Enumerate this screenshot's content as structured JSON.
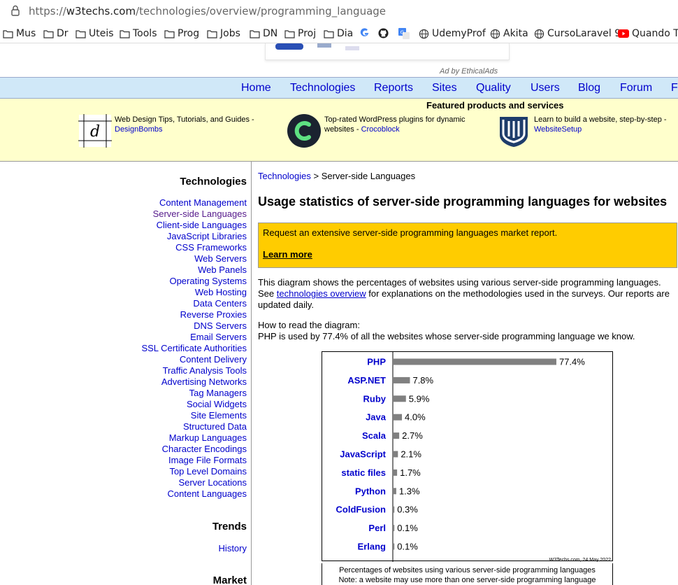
{
  "browser": {
    "url_prefix": "https://",
    "url_host": "w3techs.com",
    "url_path": "/technologies/overview/programming_language",
    "bookmarks": [
      "Mus",
      "Dr",
      "Uteis",
      "Tools",
      "Prog",
      "Jobs",
      "DN",
      "Proj",
      "Dia",
      "",
      "",
      "",
      "UdemyProf",
      "Akita",
      "CursoLaravel 9",
      "Quando Tu"
    ]
  },
  "ad": {
    "by": "Ad by EthicalAds"
  },
  "nav": [
    "Home",
    "Technologies",
    "Reports",
    "Sites",
    "Quality",
    "Users",
    "Blog",
    "Forum",
    "F"
  ],
  "featured": {
    "title": "Featured products and services",
    "items": [
      {
        "text": "Web Design Tips, Tutorials, and Guides - ",
        "link": "DesignBombs"
      },
      {
        "text": "Top-rated WordPress plugins for dynamic websites - ",
        "link": "Crocoblock"
      },
      {
        "text": "Learn to build a website, step-by-step - ",
        "link": "WebsiteSetup"
      }
    ]
  },
  "sidebar": {
    "technologies_heading": "Technologies",
    "items": [
      "Content Management",
      "Server-side Languages",
      "Client-side Languages",
      "JavaScript Libraries",
      "CSS Frameworks",
      "Web Servers",
      "Web Panels",
      "Operating Systems",
      "Web Hosting",
      "Data Centers",
      "Reverse Proxies",
      "DNS Servers",
      "Email Servers",
      "SSL Certificate Authorities",
      "Content Delivery",
      "Traffic Analysis Tools",
      "Advertising Networks",
      "Tag Managers",
      "Social Widgets",
      "Site Elements",
      "Structured Data",
      "Markup Languages",
      "Character Encodings",
      "Image File Formats",
      "Top Level Domains",
      "Server Locations",
      "Content Languages"
    ],
    "trends_heading": "Trends",
    "history": "History",
    "market_heading": "Market"
  },
  "main": {
    "crumb_link": "Technologies",
    "crumb_rest": " > Server-side Languages",
    "title": "Usage statistics of server-side programming languages for websites",
    "report_text": "Request an extensive server-side programming languages market report.",
    "report_link": "Learn more",
    "desc_1": "This diagram shows the percentages of websites using various server-side programming languages. See ",
    "desc_link": "technologies overview",
    "desc_2": " for explanations on the methodologies used in the surveys. Our reports are updated daily.",
    "howto_1": "How to read the diagram:",
    "howto_2": "PHP is used by 77.4% of all the websites whose server-side programming language we know."
  },
  "chart_data": {
    "type": "bar",
    "orientation": "horizontal",
    "categories": [
      "PHP",
      "ASP.NET",
      "Ruby",
      "Java",
      "Scala",
      "JavaScript",
      "static files",
      "Python",
      "ColdFusion",
      "Perl",
      "Erlang"
    ],
    "values": [
      77.4,
      7.8,
      5.9,
      4.0,
      2.7,
      2.1,
      1.7,
      1.3,
      0.3,
      0.1,
      0.1
    ],
    "labels": [
      "77.4%",
      "7.8%",
      "5.9%",
      "4.0%",
      "2.7%",
      "2.1%",
      "1.7%",
      "1.3%",
      "0.3%",
      "0.1%",
      "0.1%"
    ],
    "xlim": [
      0,
      100
    ],
    "credit": "W3Techs.com, 24 May 2022",
    "caption_1": "Percentages of websites using various server-side programming languages",
    "caption_2": "Note: a website may use more than one server-side programming language",
    "colors": {
      "bar": "#808080",
      "label": "#0000cc"
    }
  }
}
